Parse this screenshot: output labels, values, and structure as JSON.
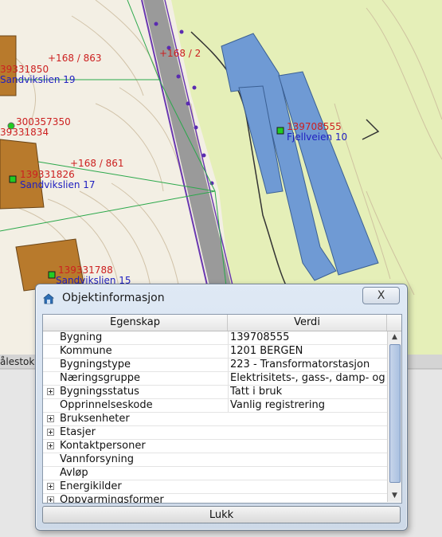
{
  "map": {
    "labels": {
      "p_168_863": "+168 / 863",
      "p_168_2": "+168 / 2",
      "p_168_861": "+168 / 861",
      "b_1850": "39331850",
      "addr_19": "Sandvikslien 19",
      "b_300357350": "300357350",
      "b_1834": "39331834",
      "b_1826": "139331826",
      "addr_17": "Sandvikslien 17",
      "b_788": "139331788",
      "addr_15": "Sandvikslien 15",
      "b_main": "139708555",
      "addr_main": "Fjellveien 10",
      "bottom_left": "ålestok"
    }
  },
  "dialog": {
    "title": "Objektinformasjon",
    "close_label": "X",
    "columns": [
      "Egenskap",
      "Verdi"
    ],
    "rows": [
      {
        "prop": "Bygning",
        "val": "139708555",
        "expandable": false
      },
      {
        "prop": "Kommune",
        "val": "1201  BERGEN",
        "expandable": false
      },
      {
        "prop": "Bygningstype",
        "val": "223 - Transformatorstasjon",
        "expandable": false
      },
      {
        "prop": "Næringsgruppe",
        "val": "Elektrisitets-, gass-, damp- og ...",
        "expandable": false
      },
      {
        "prop": "Bygningsstatus",
        "val": "Tatt i bruk",
        "expandable": true
      },
      {
        "prop": "Opprinnelseskode",
        "val": "Vanlig registrering",
        "expandable": false
      },
      {
        "prop": "Bruksenheter",
        "val": "",
        "expandable": true
      },
      {
        "prop": "Etasjer",
        "val": "",
        "expandable": true
      },
      {
        "prop": "Kontaktpersoner",
        "val": "",
        "expandable": true
      },
      {
        "prop": "Vannforsyning",
        "val": "",
        "expandable": false
      },
      {
        "prop": "Avløp",
        "val": "",
        "expandable": false
      },
      {
        "prop": "Energikilder",
        "val": "",
        "expandable": true
      },
      {
        "prop": "Oppvarmingsformer",
        "val": "",
        "expandable": true
      }
    ],
    "footer_button": "Lukk"
  }
}
